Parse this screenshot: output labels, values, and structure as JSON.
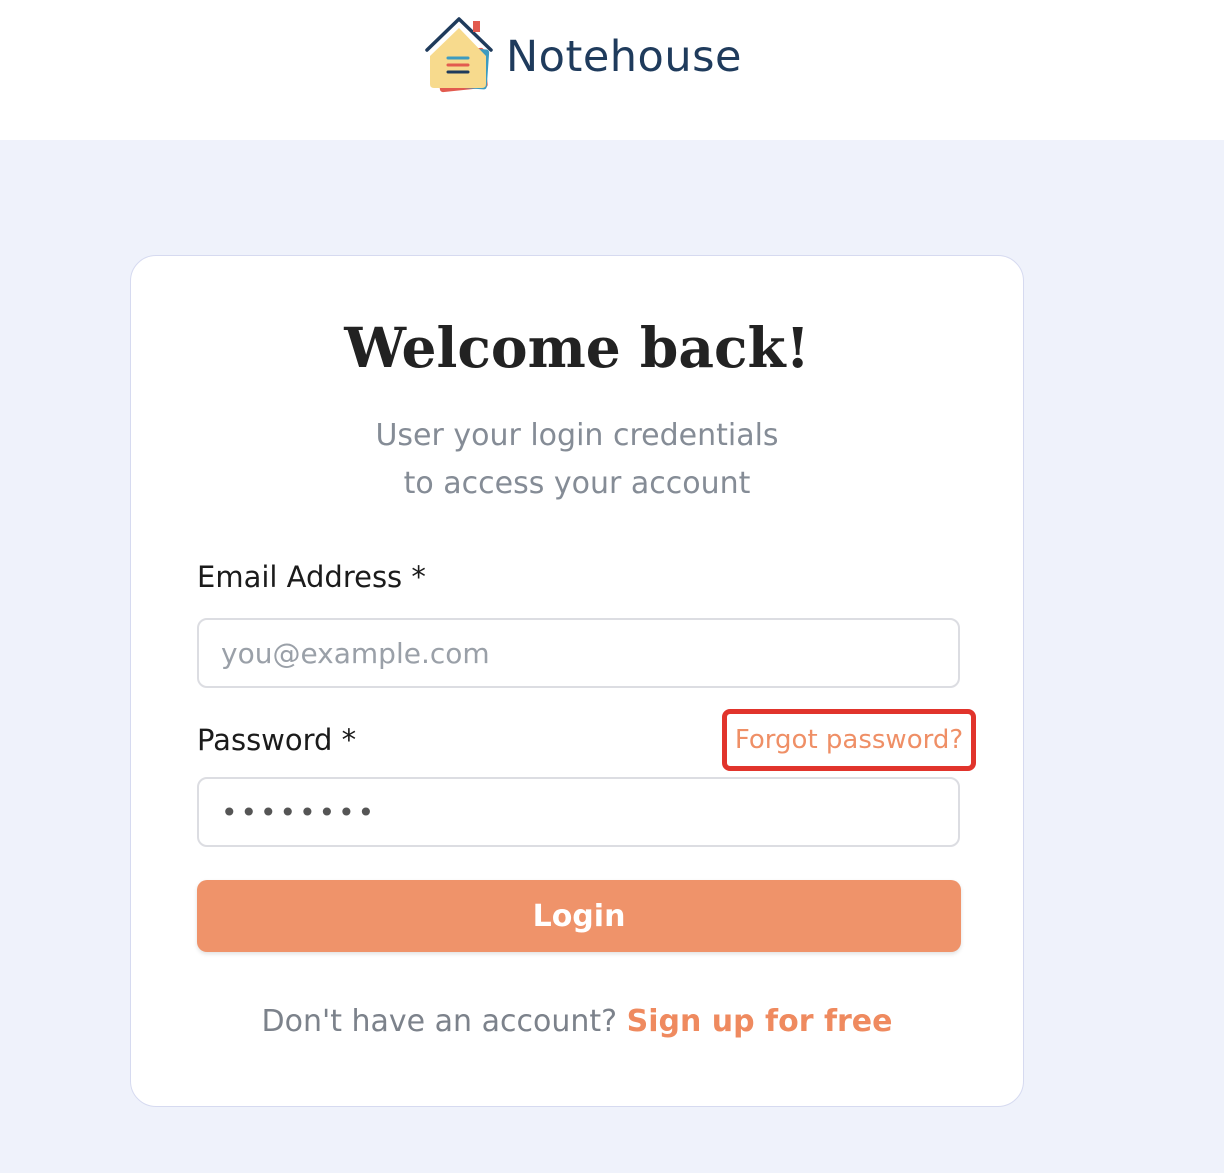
{
  "brand": {
    "name": "Notehouse"
  },
  "login_card": {
    "title": "Welcome back!",
    "subtitle_line1": "User your login credentials",
    "subtitle_line2": "to access your account",
    "email_label": "Email Address *",
    "email_placeholder": "you@example.com",
    "email_value": "",
    "password_label": "Password *",
    "password_value": "••••••••",
    "forgot_password_link": "Forgot password?",
    "login_button": "Login",
    "signup_prompt": "Don't have an account?",
    "signup_link": "Sign up for free"
  },
  "colors": {
    "accent": "#ef936a",
    "highlight_border": "#e1342c",
    "brand_text": "#1f3b5c",
    "page_background": "#eff2fb"
  }
}
